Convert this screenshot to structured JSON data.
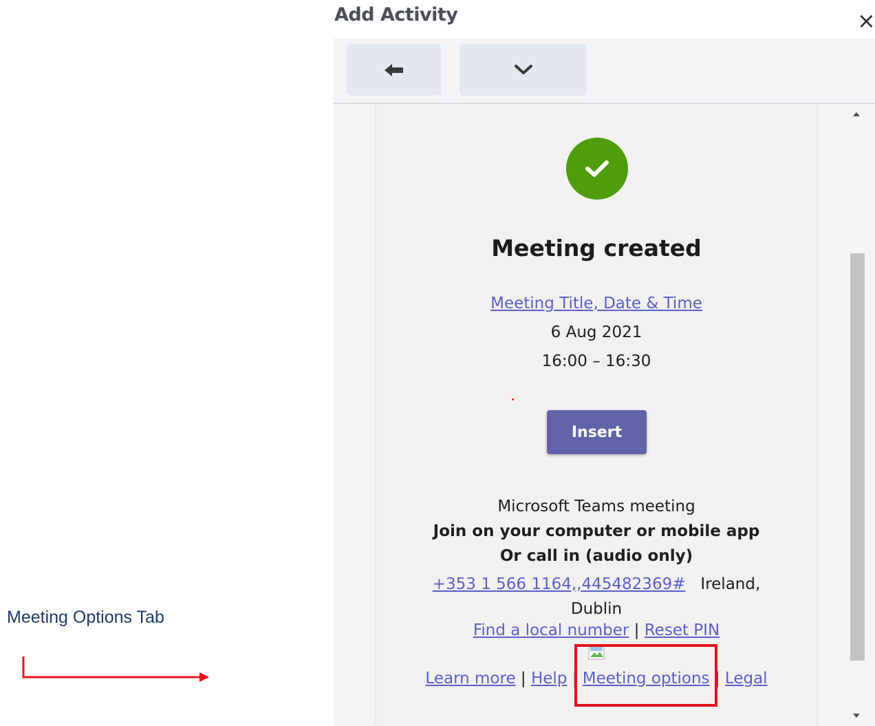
{
  "dialog": {
    "title": "Add Activity",
    "close_glyph": "×"
  },
  "toolbar": {
    "back_icon": "arrow-left-icon",
    "more_icon": "chevron-down-icon"
  },
  "card": {
    "status_icon": "check-circle-icon",
    "status_color": "#4f9d0a",
    "heading": "Meeting created",
    "meeting_link": "Meeting Title, Date & Time",
    "date": "6 Aug 2021",
    "time": "16:00 – 16:30",
    "insert_label": "Insert",
    "insert_color": "#6264a7",
    "teams_title": "Microsoft Teams meeting",
    "join_text": "Join on your computer or mobile app",
    "call_text": "Or call in (audio only)",
    "phone_link": "+353 1 566 1164,,445482369#",
    "phone_location": "Ireland, Dublin",
    "find_local": "Find a local number",
    "reset_pin": "Reset PIN",
    "separator": "|",
    "footer_links": {
      "learn_more": "Learn more",
      "help": "Help",
      "meeting_options": "Meeting options",
      "legal": "Legal"
    },
    "link_color": "#5b5fc7"
  },
  "annotation": {
    "label": "Meeting Options Tab",
    "color": "#e5121d"
  }
}
